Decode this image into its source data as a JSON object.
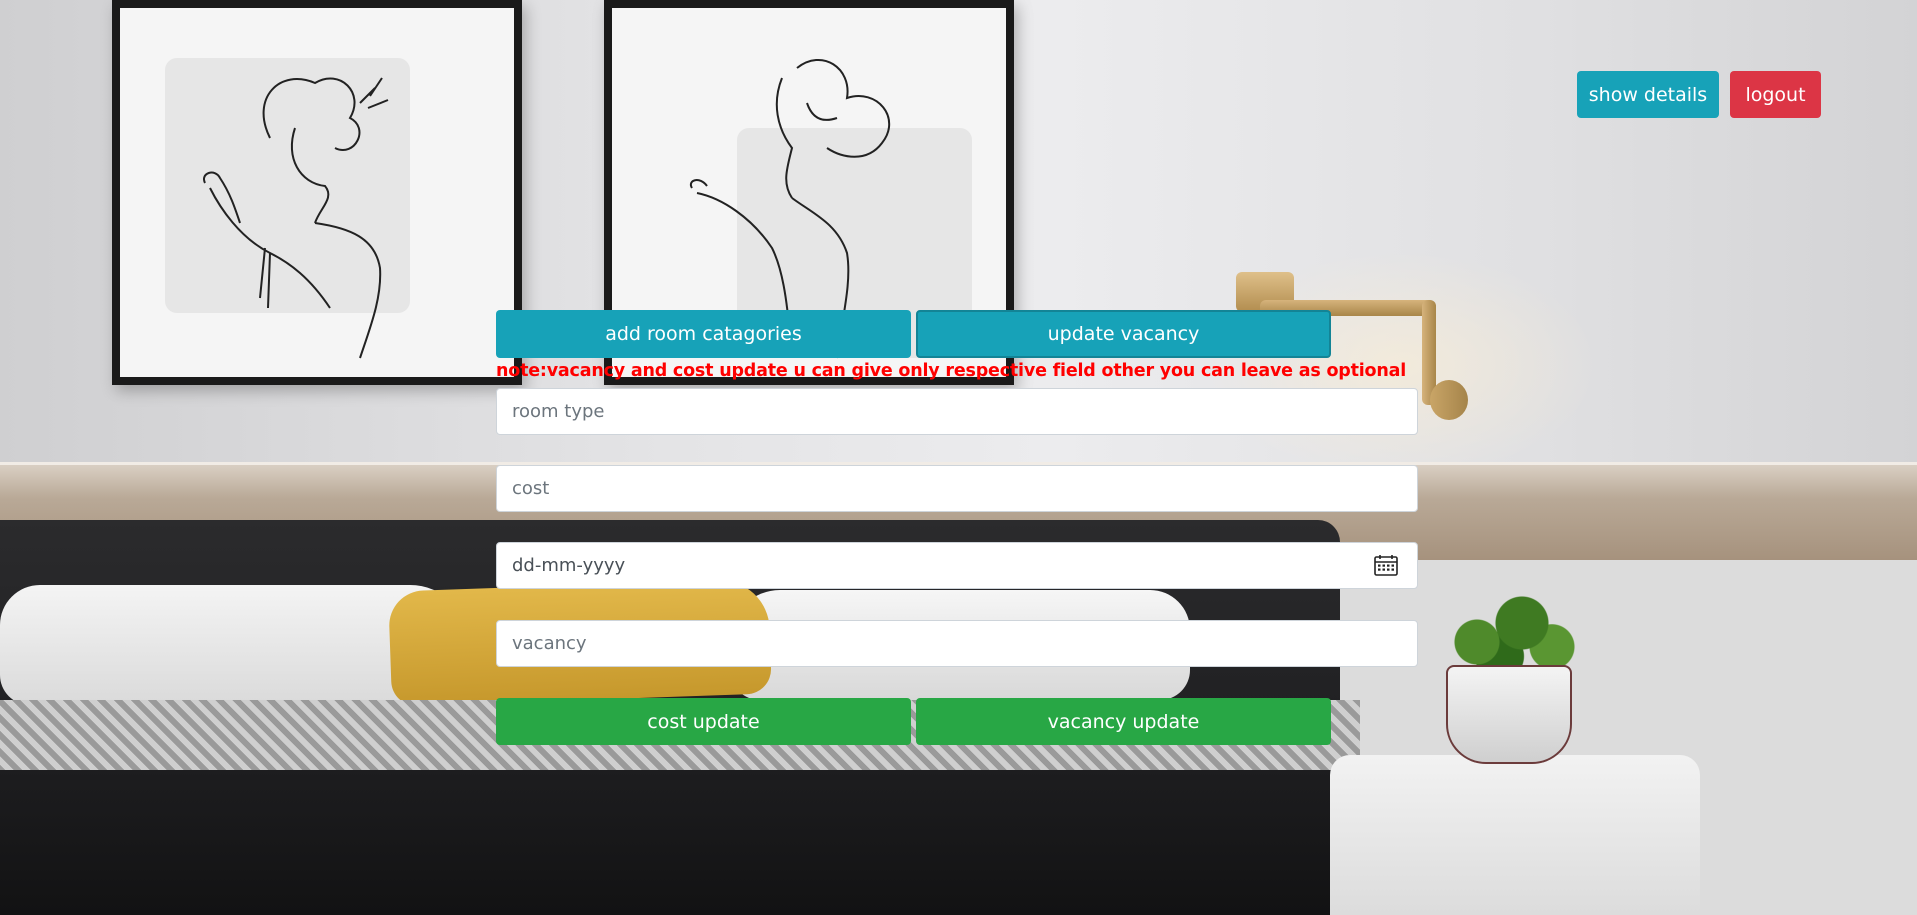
{
  "header": {
    "show_details_label": "show details",
    "logout_label": "logout"
  },
  "tabs": {
    "add_label": "add room catagories",
    "update_label": "update vacancy"
  },
  "note": "note:vacancy and cost update u can give only respective field other you can leave as optional",
  "form": {
    "room_type_placeholder": "room type",
    "cost_placeholder": "cost",
    "date_placeholder": "dd-mm-yyyy",
    "vacancy_placeholder": "vacancy"
  },
  "actions": {
    "cost_update_label": "cost update",
    "vacancy_update_label": "vacancy update"
  },
  "icons": {
    "date_picker": "calendar-icon"
  },
  "colors": {
    "info": "#17a2b8",
    "danger": "#dc3545",
    "success": "#28a745",
    "note": "#ff0000"
  }
}
